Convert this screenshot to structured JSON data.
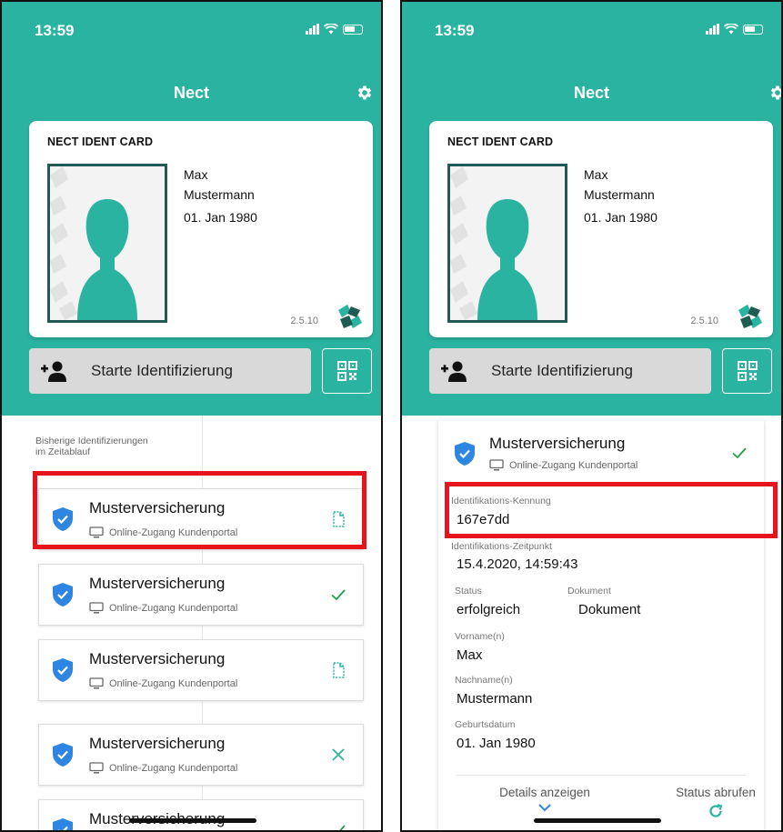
{
  "status_bar": {
    "time": "13:59"
  },
  "app": {
    "title": "Nect"
  },
  "card": {
    "title": "NECT IDENT CARD",
    "first_name": "Max",
    "last_name": "Mustermann",
    "birthdate": "01. Jan 1980",
    "version": "2.5.10"
  },
  "actions": {
    "start_label": "Starte Identifizierung"
  },
  "timeline": {
    "section_label_line1": "Bisherige Identifizierungen",
    "section_label_line2": "im Zeitablauf",
    "entries": [
      {
        "name": "Musterversicherung",
        "portal": "Online-Zugang Kundenportal",
        "status": "document"
      },
      {
        "name": "Musterversicherung",
        "portal": "Online-Zugang Kundenportal",
        "status": "success"
      },
      {
        "name": "Musterversicherung",
        "portal": "Online-Zugang Kundenportal",
        "status": "document"
      },
      {
        "name": "Musterversicherung",
        "portal": "Online-Zugang Kundenportal",
        "status": "failed"
      },
      {
        "name": "Musterversicherung",
        "portal": "",
        "status": "success"
      }
    ]
  },
  "detail": {
    "name": "Musterversicherung",
    "portal": "Online-Zugang Kundenportal",
    "id_label": "Identifikations-Kennung",
    "id_value": "167e7dd",
    "time_label": "Identifikations-Zeitpunkt",
    "time_value": "15.4.2020, 14:59:43",
    "status_label": "Status",
    "status_value": "erfolgreich",
    "document_label": "Dokument",
    "document_value": "Dokument",
    "firstname_label": "Vorname(n)",
    "firstname_value": "Max",
    "lastname_label": "Nachname(n)",
    "lastname_value": "Mustermann",
    "birth_label": "Geburtsdatum",
    "birth_value": "01. Jan 1980",
    "details_button": "Details anzeigen",
    "status_button": "Status abrufen"
  },
  "colors": {
    "teal": "#2bb3a1",
    "highlight": "#e8141c",
    "shield": "#2f86e0",
    "check": "#1e9e4a"
  }
}
